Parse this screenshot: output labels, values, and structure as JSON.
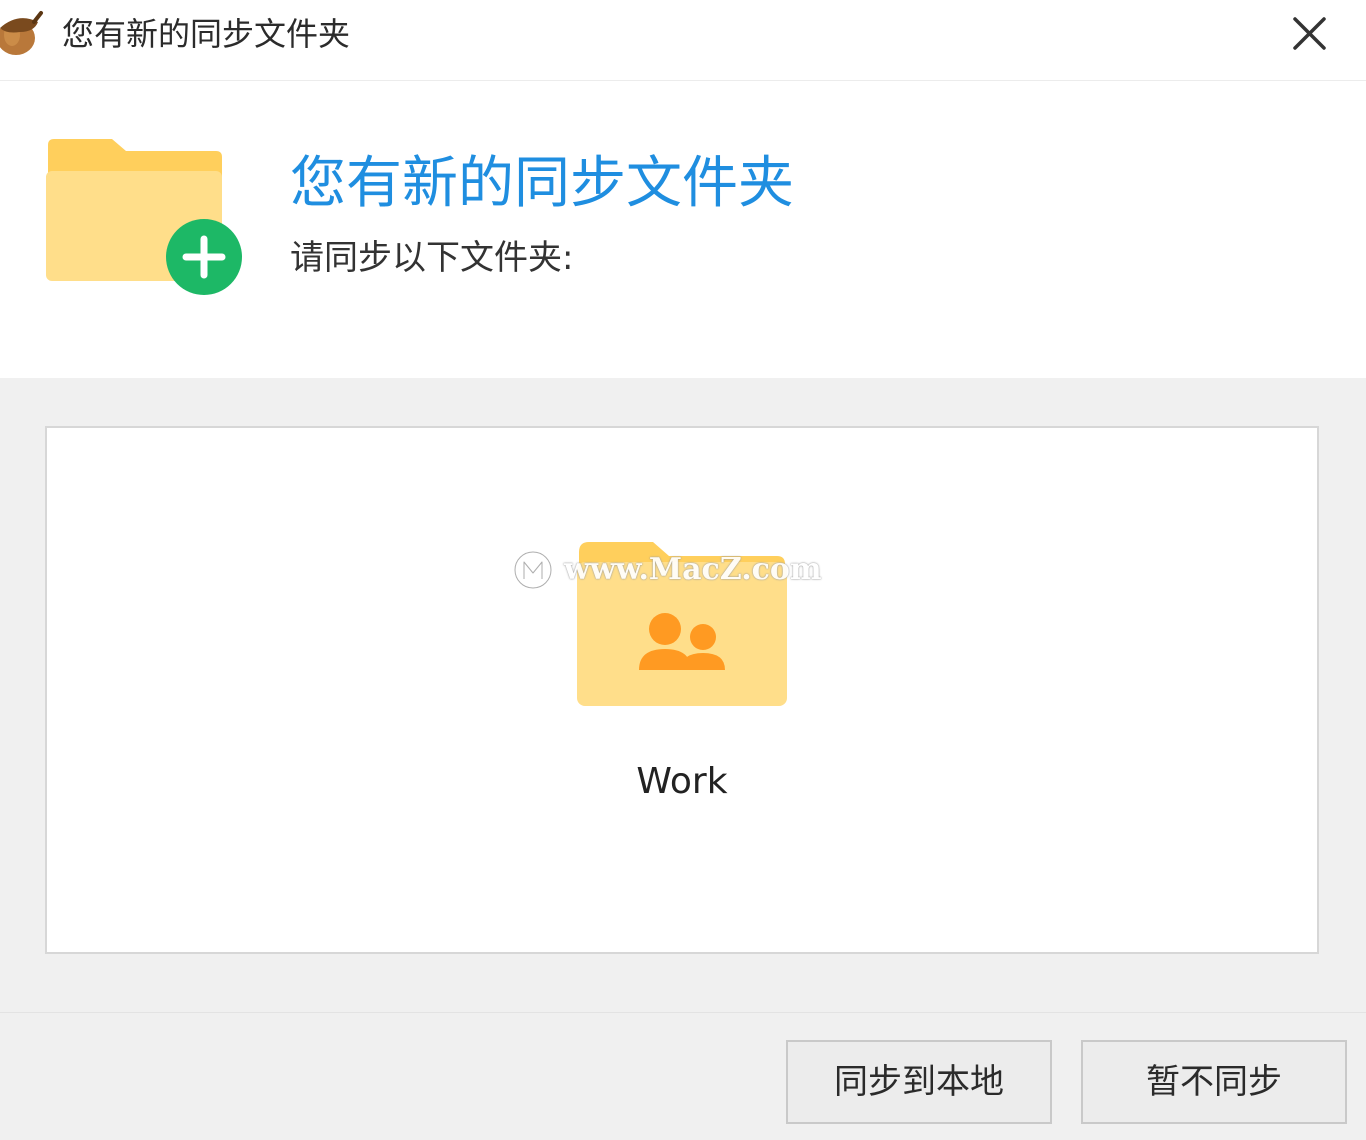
{
  "window": {
    "title": "您有新的同步文件夹",
    "app_icon": "acorn-icon",
    "close_icon": "close-icon"
  },
  "header": {
    "heading": "您有新的同步文件夹",
    "subheading": "请同步以下文件夹:",
    "icon": "folder-add-icon"
  },
  "folders": [
    {
      "name": "Work",
      "icon": "shared-folder-icon"
    }
  ],
  "watermark": {
    "text": "www.MacZ.com",
    "icon": "macz-logo-icon"
  },
  "buttons": {
    "sync_label": "同步到本地",
    "skip_label": "暂不同步"
  },
  "colors": {
    "heading": "#1f8ee0",
    "folder": "#ffde8a",
    "folder_tab": "#ffcf5c",
    "add_badge": "#1db866",
    "people": "#ff9a22"
  }
}
